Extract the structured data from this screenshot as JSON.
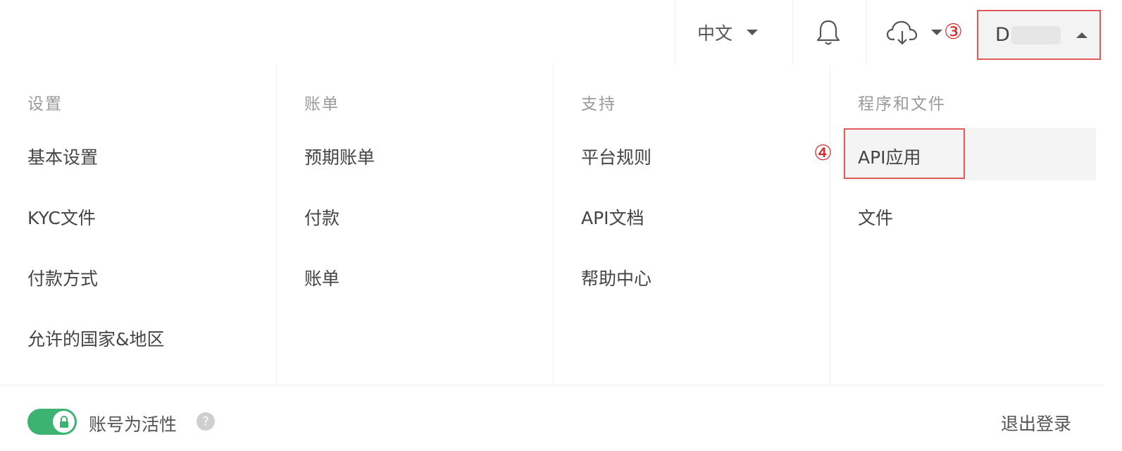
{
  "header": {
    "language": "中文",
    "user_initial": "D",
    "marker_user": "③"
  },
  "menu": {
    "columns": [
      {
        "title": "设置",
        "items": [
          "基本设置",
          "KYC文件",
          "付款方式",
          "允许的国家&地区"
        ]
      },
      {
        "title": "账单",
        "items": [
          "预期账单",
          "付款",
          "账单"
        ]
      },
      {
        "title": "支持",
        "items": [
          "平台规则",
          "API文档",
          "帮助中心"
        ]
      },
      {
        "title": "程序和文件",
        "items": [
          "API应用",
          "文件"
        ]
      }
    ],
    "marker_api": "④"
  },
  "footer": {
    "active_label": "账号为活性",
    "help_symbol": "?",
    "logout": "退出登录"
  },
  "colors": {
    "accent": "#e35a5a",
    "toggle": "#3cb371"
  },
  "icons": {
    "bell": "bell-icon",
    "cloud": "cloud-download-icon",
    "lock": "lock-icon",
    "help": "question-icon"
  }
}
